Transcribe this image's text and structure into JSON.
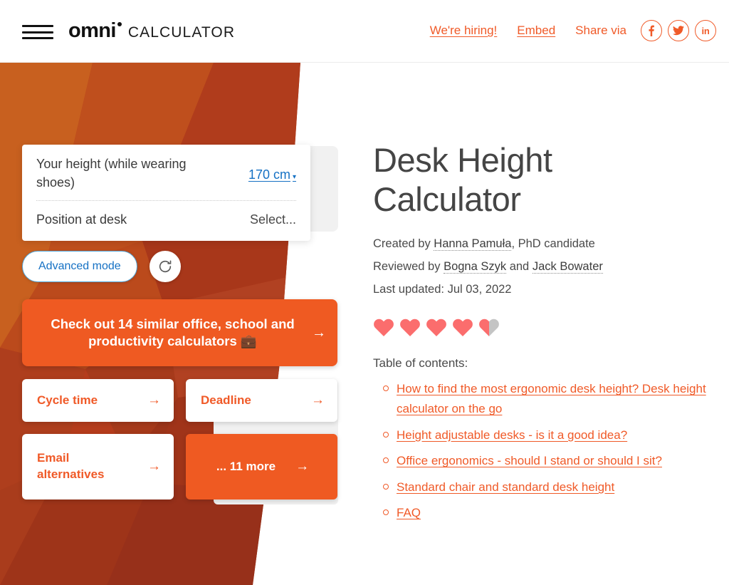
{
  "header": {
    "menu_icon": "hamburger-icon",
    "brand_primary": "omni",
    "brand_secondary": "CALCULATOR",
    "hiring_label": "We're hiring!",
    "embed_label": "Embed",
    "share_label": "Share via",
    "social": [
      {
        "name": "facebook-icon",
        "glyph": "f"
      },
      {
        "name": "twitter-icon",
        "glyph": ""
      },
      {
        "name": "linkedin-icon",
        "glyph": "in"
      }
    ],
    "accent_color": "#f05a28"
  },
  "calculator": {
    "fields": [
      {
        "label": "Your height (while wearing shoes)",
        "value": "170 cm",
        "caret": "▾",
        "value_color": "#1571c4"
      },
      {
        "label": "Position at desk",
        "value": "Select...",
        "value_color": "#4a4a4a"
      }
    ],
    "advanced_mode_label": "Advanced mode",
    "reload_icon": "refresh-icon"
  },
  "cta": {
    "text": "Check out 14 similar office, school and productivity calculators 💼",
    "arrow": "→",
    "background": "#ef5a22"
  },
  "tiles": [
    {
      "label": "Cycle time",
      "arrow": "→",
      "style": "white"
    },
    {
      "label": "Deadline",
      "arrow": "→",
      "style": "white"
    },
    {
      "label": "Email alternatives",
      "arrow": "→",
      "style": "white"
    },
    {
      "label": "... 11 more",
      "arrow": "→",
      "style": "orange"
    }
  ],
  "article": {
    "title": "Desk Height Calculator",
    "created_prefix": "Created by ",
    "created_author": "Hanna Pamuła",
    "created_suffix": ", PhD candidate",
    "reviewed_prefix": "Reviewed by ",
    "reviewer_1": "Bogna Szyk",
    "reviewed_join": " and ",
    "reviewer_2": "Jack Bowater",
    "last_updated": "Last updated: Jul 03, 2022",
    "rating": {
      "full_hearts": 4,
      "half_hearts": 1,
      "total": 5,
      "fill_color": "#fb6d6d",
      "empty_color": "#c4c4c4"
    },
    "toc_title": "Table of contents:",
    "toc": [
      "How to find the most ergonomic desk height? Desk height calculator on the go",
      "Height adjustable desks - is it a good idea?",
      "Office ergonomics - should I stand or should I sit?",
      "Standard chair and standard desk height",
      "FAQ"
    ]
  }
}
